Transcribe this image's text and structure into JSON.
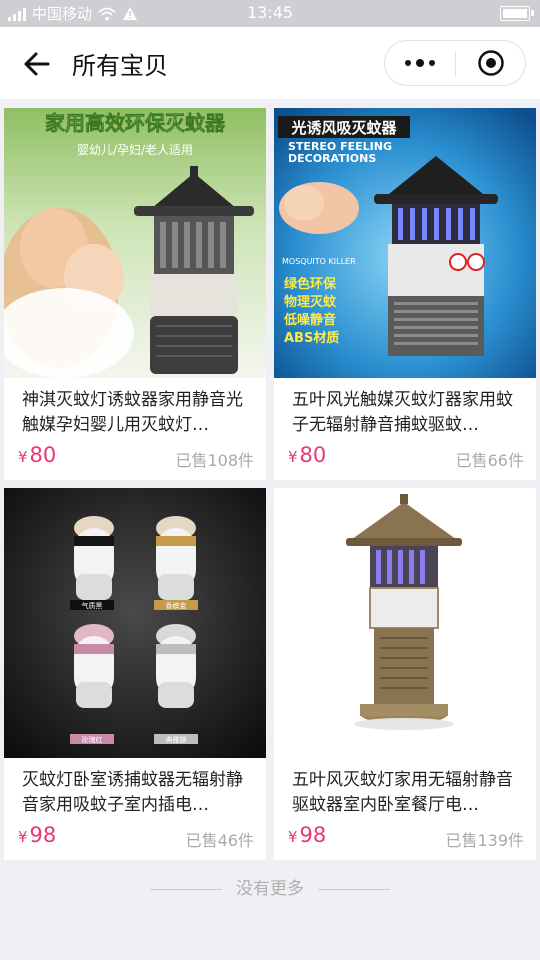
{
  "status_bar": {
    "carrier": "中国移动",
    "time": "13:45"
  },
  "nav": {
    "title": "所有宝贝"
  },
  "products": [
    {
      "name": "神淇灭蚊灯诱蚊器家用静音光触媒孕妇婴儿用灭蚊灯…",
      "currency": "¥",
      "price": "80",
      "sold": "已售108件",
      "banner": "家用高效环保灭蚊器",
      "sub_banner": "婴幼儿/孕妇/老人适用"
    },
    {
      "name": "五叶风光触媒灭蚊灯器家用蚊子无辐射静音捕蚊驱蚊…",
      "currency": "¥",
      "price": "80",
      "sold": "已售66件",
      "banner": "光诱风吸灭蚊器",
      "banner_en_1": "STEREO FEELING",
      "banner_en_2": "DECORATIONS",
      "features": [
        "绿色环保",
        "物理灭蚊",
        "低噪静音",
        "ABS材质"
      ],
      "model_text": "MOSQUITO KILLER"
    },
    {
      "name": "灭蚊灯卧室诱捕蚊器无辐射静音家用吸蚊子室内插电…",
      "currency": "¥",
      "price": "98",
      "sold": "已售46件",
      "variants": [
        "气质黑",
        "香槟金",
        "玫瑰红",
        "典雅银"
      ]
    },
    {
      "name": "五叶风灭蚊灯家用无辐射静音驱蚊器室内卧室餐厅电…",
      "currency": "¥",
      "price": "98",
      "sold": "已售139件"
    }
  ],
  "footer": {
    "text": "没有更多"
  }
}
